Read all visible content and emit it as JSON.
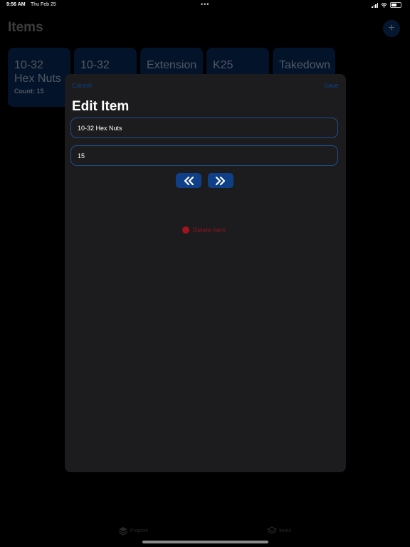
{
  "status_bar": {
    "time": "9:56 AM",
    "date": "Thu Feb 25",
    "dots": "•••"
  },
  "background": {
    "title": "Items",
    "add_label": "+",
    "cards": [
      {
        "name": "10-32 Hex Nuts",
        "count": "Count: 15"
      },
      {
        "name": "10-32"
      },
      {
        "name": "Extension"
      },
      {
        "name": "K25"
      },
      {
        "name": "Takedown"
      }
    ],
    "tabs": [
      {
        "label": "Projects",
        "icon": "stack-icon"
      },
      {
        "label": "Items",
        "icon": "layers-icon"
      }
    ]
  },
  "sheet": {
    "cancel": "Cancel",
    "save": "Save",
    "title": "Edit Item",
    "name_value": "10-32 Hex Nuts",
    "count_value": "15",
    "decrement_icon": "chevrons-left-icon",
    "increment_icon": "chevrons-right-icon",
    "delete_label": "Delete Item"
  },
  "colors": {
    "accent": "#0e3f87",
    "destructive": "#a5121e",
    "sheet_bg": "#1c1c1e"
  }
}
